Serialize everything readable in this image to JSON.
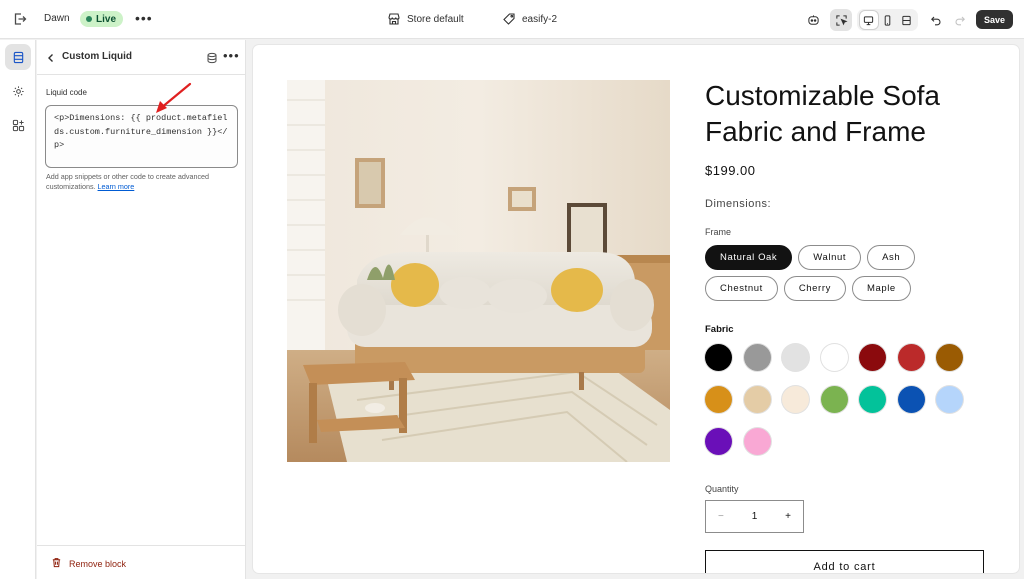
{
  "topbar": {
    "theme_name": "Dawn",
    "live_badge": "Live",
    "more_label": "•••",
    "store_label": "Store default",
    "product_label": "easify-2",
    "save_label": "Save"
  },
  "panel": {
    "title": "Custom Liquid",
    "more_label": "•••",
    "field_label": "Liquid code",
    "code_value": "<p>Dimensions: {{ product.metafields.custom.furniture_dimension }}</p>",
    "help_text": "Add app snippets or other code to create advanced customizations.",
    "help_link": "Learn more",
    "remove_label": "Remove block"
  },
  "product": {
    "title": "Customizable Sofa Fabric and Frame",
    "price": "$199.00",
    "dimensions_text": "Dimensions:",
    "frame_label": "Frame",
    "frame_options": [
      "Natural Oak",
      "Walnut",
      "Ash",
      "Chestnut",
      "Cherry",
      "Maple"
    ],
    "frame_selected": "Natural Oak",
    "fabric_label": "Fabric",
    "fabric_colors": [
      "#000000",
      "#999999",
      "#e2e2e2",
      "#ffffff",
      "#8b0a0d",
      "#bb2a2a",
      "#9a5b03",
      "#d79019",
      "#e4cca6",
      "#f7eada",
      "#7bb350",
      "#03c29a",
      "#0b52b3",
      "#b5d5fb",
      "#6a0fb8",
      "#f9a8d4"
    ],
    "quantity_label": "Quantity",
    "quantity_minus": "−",
    "quantity_value": "1",
    "quantity_plus": "+",
    "add_to_cart": "Add to cart"
  },
  "colors": {
    "accent_dark": "#303030",
    "live_bg": "#cdf2c8",
    "danger": "#8e1f0b",
    "link": "#005bd3",
    "annotation": "#e02020"
  }
}
